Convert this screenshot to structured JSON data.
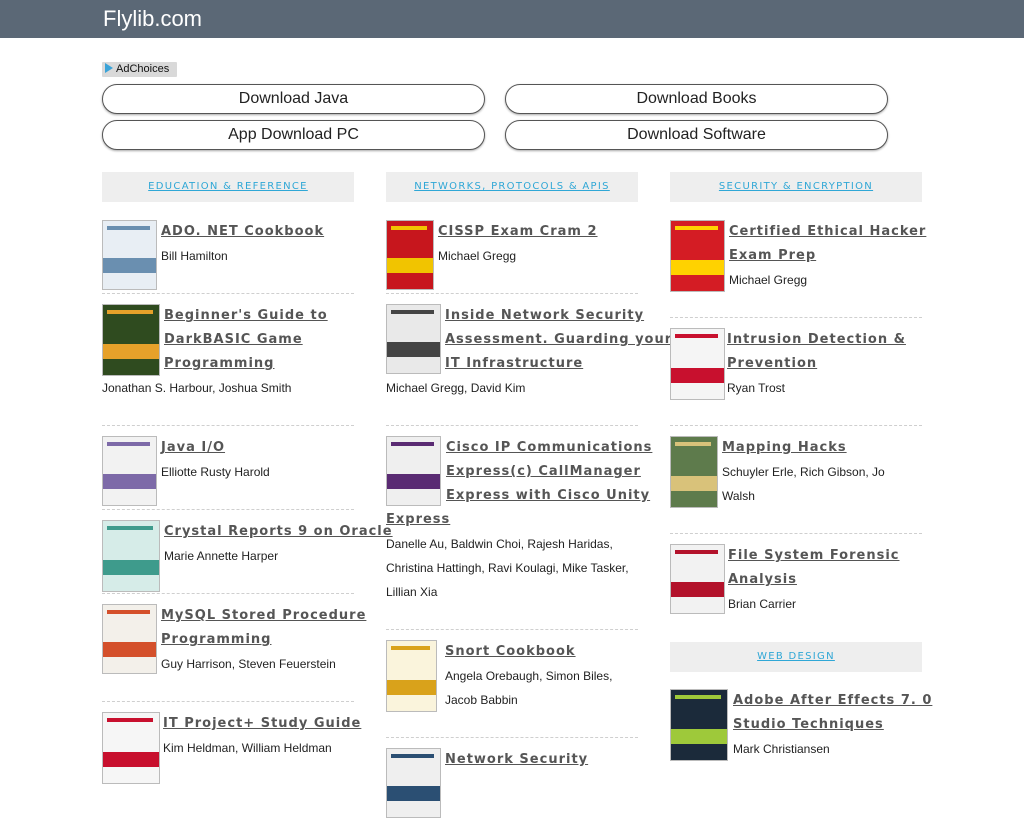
{
  "site": {
    "title": "Flylib.com"
  },
  "ads": {
    "adchoices_label": "AdChoices",
    "buttons": [
      "Download Java",
      "Download Books",
      "App Download PC",
      "Download Software"
    ]
  },
  "columns": [
    {
      "heading": "EDUCATION & REFERENCE",
      "books": [
        {
          "title_lines": [
            "ADO. NET Cookbook"
          ],
          "author_lines": [
            "Bill Hamilton"
          ]
        },
        {
          "title_lines": [
            "Beginner's Guide to",
            "DarkBASIC Game",
            "Programming"
          ],
          "author_lines": [
            "Jonathan S. Harbour, Joshua Smith"
          ]
        },
        {
          "title_lines": [
            "Java I/O"
          ],
          "author_lines": [
            "Elliotte Rusty Harold"
          ]
        },
        {
          "title_lines": [
            "Crystal Reports 9 on Oracle"
          ],
          "author_lines": [
            "Marie Annette Harper"
          ]
        },
        {
          "title_lines": [
            "MySQL Stored Procedure",
            "Programming"
          ],
          "author_lines": [
            "Guy Harrison, Steven Feuerstein"
          ]
        },
        {
          "title_lines": [
            "IT Project+ Study Guide"
          ],
          "author_lines": [
            "Kim Heldman, William Heldman"
          ]
        }
      ]
    },
    {
      "heading": "NETWORKS, PROTOCOLS & APIS",
      "books": [
        {
          "title_lines": [
            "CISSP Exam Cram 2"
          ],
          "author_lines": [
            "Michael Gregg"
          ]
        },
        {
          "title_lines": [
            "Inside Network Security",
            "Assessment. Guarding your",
            "IT Infrastructure"
          ],
          "author_lines": [
            "Michael Gregg, David Kim"
          ]
        },
        {
          "title_lines": [
            "Cisco IP Communications",
            "Express(c) CallManager",
            "Express with Cisco Unity",
            "Express"
          ],
          "author_lines": [
            "Danelle Au, Baldwin Choi, Rajesh Haridas,",
            "Christina Hattingh, Ravi Koulagi, Mike Tasker,",
            "Lillian Xia"
          ]
        },
        {
          "title_lines": [
            "Snort Cookbook"
          ],
          "author_lines": [
            "Angela Orebaugh, Simon Biles,",
            "Jacob Babbin"
          ]
        },
        {
          "title_lines": [
            "Network Security"
          ],
          "author_lines": []
        }
      ]
    },
    {
      "heading": "SECURITY & ENCRYPTION",
      "books": [
        {
          "title_lines": [
            "Certified Ethical Hacker",
            "Exam Prep"
          ],
          "author_lines": [
            "Michael Gregg"
          ]
        },
        {
          "title_lines": [
            "Intrusion Detection &",
            "Prevention"
          ],
          "author_lines": [
            "Ryan Trost"
          ]
        },
        {
          "title_lines": [
            "Mapping Hacks"
          ],
          "author_lines": [
            "Schuyler Erle, Rich Gibson, Jo",
            "Walsh"
          ]
        },
        {
          "title_lines": [
            "File System Forensic",
            "Analysis"
          ],
          "author_lines": [
            "Brian Carrier"
          ]
        }
      ]
    },
    {
      "heading": "WEB DESIGN",
      "books": [
        {
          "title_lines": [
            "Adobe After Effects 7. 0",
            "Studio Techniques"
          ],
          "author_lines": [
            "Mark Christiansen"
          ]
        }
      ]
    }
  ],
  "colors": {
    "topbar": "#5b6876",
    "heading_link": "#2fa7d6",
    "heading_bg": "#eeeeee"
  }
}
